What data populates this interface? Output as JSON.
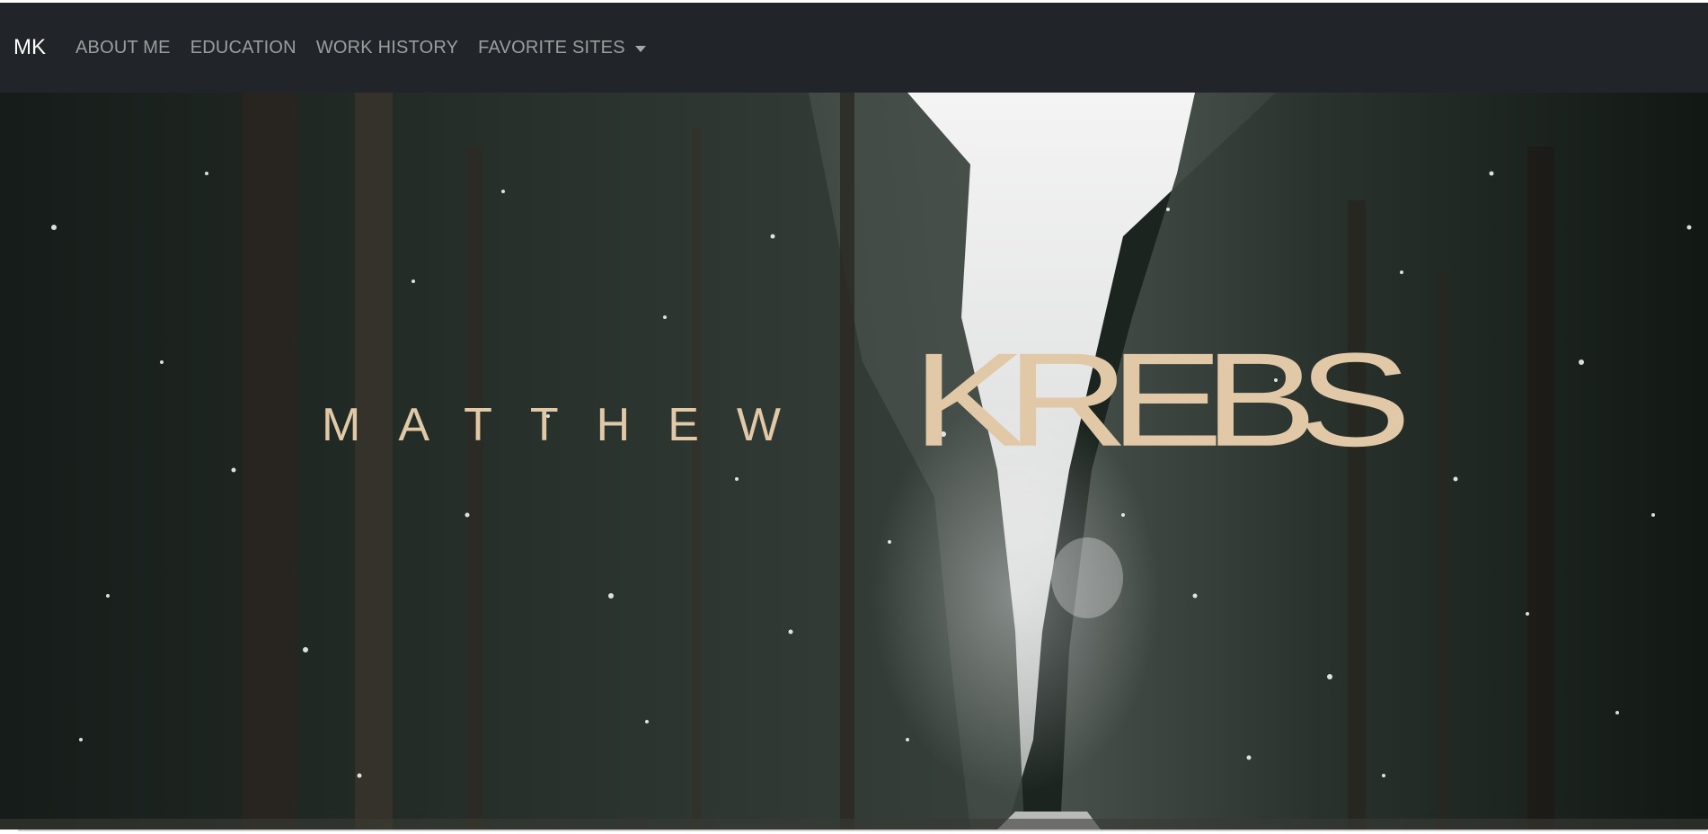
{
  "navbar": {
    "brand": "MK",
    "links": [
      {
        "label": "ABOUT ME"
      },
      {
        "label": "EDUCATION"
      },
      {
        "label": "WORK HISTORY"
      },
      {
        "label": "FAVORITE SITES",
        "dropdown": true
      }
    ]
  },
  "hero": {
    "first_name": "MATTHEW",
    "last_name": "KREBS",
    "background": "snowy-forest-road-video"
  },
  "colors": {
    "navbar_bg": "#212529",
    "name_accent": "#e1c8a6",
    "nav_text": "#a7a9ab"
  }
}
